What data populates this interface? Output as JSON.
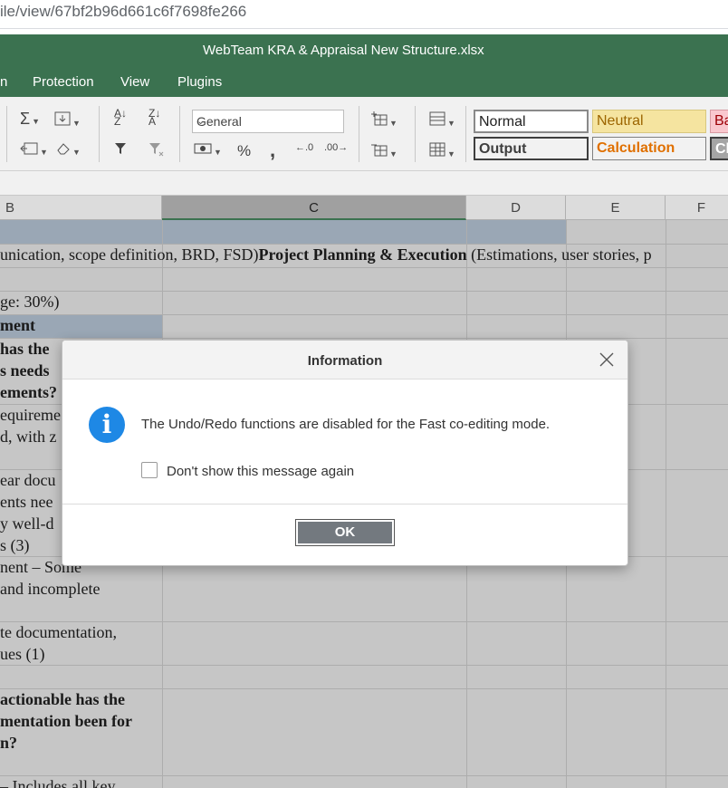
{
  "browser": {
    "url": "ile/view/67bf2b96d661c6f7698fe266"
  },
  "window": {
    "title": "WebTeam KRA & Appraisal New Structure.xlsx"
  },
  "menu": {
    "items": [
      "n",
      "Protection",
      "View",
      "Plugins"
    ]
  },
  "toolbar": {
    "number_format": "General",
    "percent": "%",
    "comma": ",",
    "styles": {
      "normal": "Normal",
      "neutral": "Neutral",
      "bad": "Ba",
      "output": "Output",
      "calculation": "Calculation",
      "check": "Cl"
    }
  },
  "grid": {
    "columns": [
      "B",
      "C",
      "D",
      "E",
      "F"
    ],
    "selected_column": "C",
    "rows": [
      "unication, scope definition, BRD, FSD)",
      "Project Planning & Execution",
      " (Estimations, user stories, p",
      "ge: 30%)",
      "ment",
      " has the",
      "s needs",
      "ements?",
      "equireme",
      "d, with z",
      "ear docu",
      "ents nee",
      "y well-d",
      "s (3)",
      "nent – Some",
      " and incomplete",
      "te documentation,",
      "ues (1)",
      "actionable has the",
      "mentation been for",
      "n?",
      "– Includes all key"
    ]
  },
  "dialog": {
    "title": "Information",
    "message": "The Undo/Redo functions are disabled for the Fast co-editing mode.",
    "checkbox_label": "Don't show this message again",
    "ok_label": "OK",
    "icon_glyph": "i"
  }
}
